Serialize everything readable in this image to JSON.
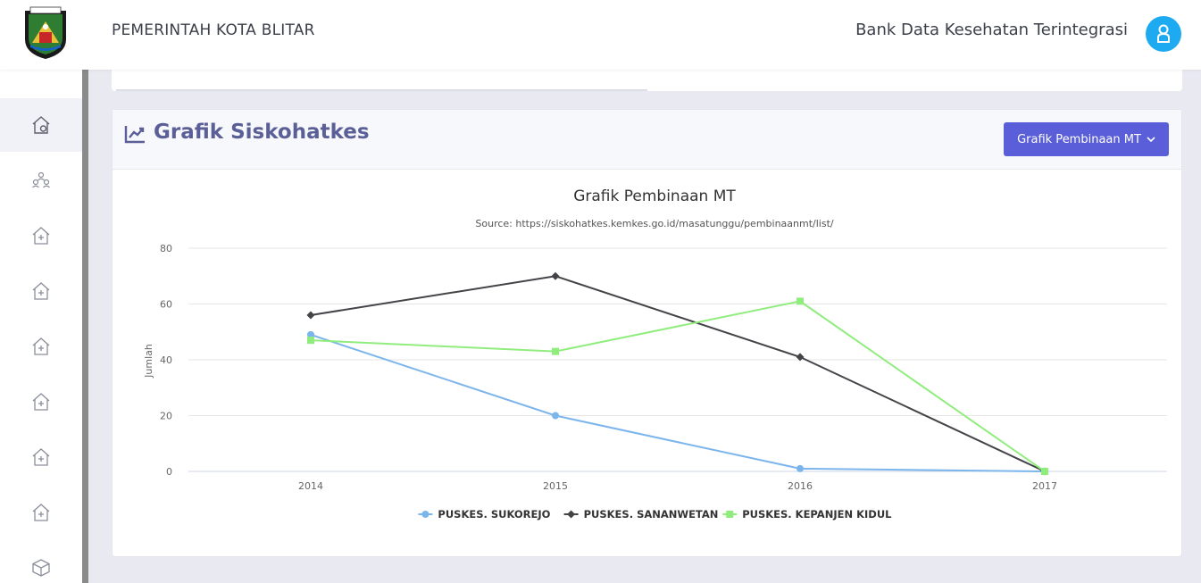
{
  "header": {
    "gov_name": "PEMERINTAH KOTA BLITAR",
    "app_title": "Bank Data Kesehatan Terintegrasi",
    "logo_icon": "kota-blitar-crest-icon",
    "avatar_icon": "user-icon"
  },
  "sidebar": {
    "items": [
      {
        "icon": "home-icon"
      },
      {
        "icon": "users-icon"
      },
      {
        "icon": "hospital-icon"
      },
      {
        "icon": "hospital-icon"
      },
      {
        "icon": "hospital-icon"
      },
      {
        "icon": "hospital-icon"
      },
      {
        "icon": "hospital-icon"
      },
      {
        "icon": "hospital-icon"
      },
      {
        "icon": "box-icon"
      }
    ]
  },
  "card": {
    "title": "Grafik Siskohatkes",
    "title_icon": "line-chart-icon",
    "dropdown_label": "Grafik Pembinaan MT"
  },
  "colors": {
    "accent": "#5a5ed8",
    "series_blue": "#7cb5ec",
    "series_dark": "#434348",
    "series_green": "#90ed7d"
  },
  "chart_data": {
    "type": "line",
    "title": "Grafik Pembinaan MT",
    "subtitle": "Source: https://siskohatkes.kemkes.go.id/masatunggu/pembinaanmt/list/",
    "ylabel": "Jumlah",
    "xlabel": "",
    "x": [
      "2014",
      "2015",
      "2016",
      "2017"
    ],
    "ylim": [
      0,
      80
    ],
    "yticks": [
      0,
      20,
      40,
      60,
      80
    ],
    "grid": true,
    "legend": "bottom-center",
    "series": [
      {
        "name": "PUSKES. SUKOREJO",
        "values": [
          49,
          20,
          1,
          0
        ],
        "color": "#7cb5ec",
        "marker": "circle"
      },
      {
        "name": "PUSKES. SANANWETAN",
        "values": [
          56,
          70,
          41,
          0
        ],
        "color": "#434348",
        "marker": "diamond"
      },
      {
        "name": "PUSKES. KEPANJEN KIDUL",
        "values": [
          47,
          43,
          61,
          0
        ],
        "color": "#90ed7d",
        "marker": "square"
      }
    ]
  }
}
